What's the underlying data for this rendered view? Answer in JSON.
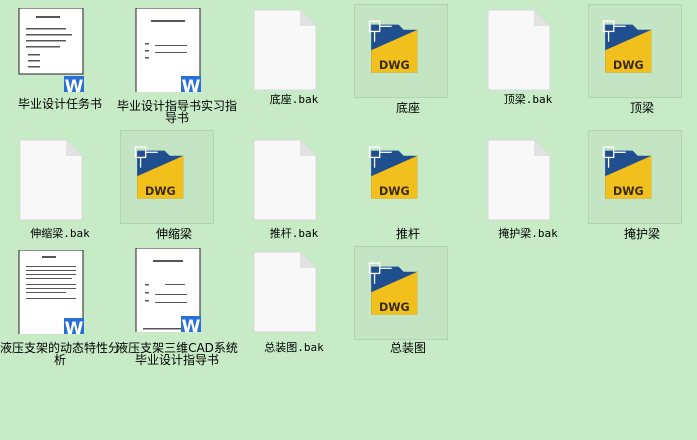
{
  "files": [
    {
      "label": "毕业设计任务书",
      "type": "word"
    },
    {
      "label": "毕业设计指导书实习指导书",
      "type": "word2"
    },
    {
      "label": "底座.bak",
      "type": "bak"
    },
    {
      "label": "底座",
      "type": "dwg"
    },
    {
      "label": "顶梁.bak",
      "type": "bak"
    },
    {
      "label": "顶梁",
      "type": "dwg"
    },
    {
      "label": "伸缩梁.bak",
      "type": "bak"
    },
    {
      "label": "伸缩梁",
      "type": "dwg"
    },
    {
      "label": "推杆.bak",
      "type": "bak"
    },
    {
      "label": "推杆",
      "type": "dwg"
    },
    {
      "label": "掩护梁.bak",
      "type": "bak"
    },
    {
      "label": "掩护梁",
      "type": "dwg"
    },
    {
      "label": "液压支架的动态特性分析",
      "type": "word"
    },
    {
      "label": "液压支架三维CAD系统 毕业设计指导书",
      "type": "word2"
    },
    {
      "label": "总装图.bak",
      "type": "bak"
    },
    {
      "label": "总装图",
      "type": "dwg"
    }
  ],
  "badges": {
    "word": "W",
    "dwg": "DWG"
  },
  "colors": {
    "background": "#c7ebc7",
    "word_blue": "#2a6fd4",
    "dwg_yellow": "#f2c01c",
    "dwg_blue": "#1f4f8f"
  }
}
